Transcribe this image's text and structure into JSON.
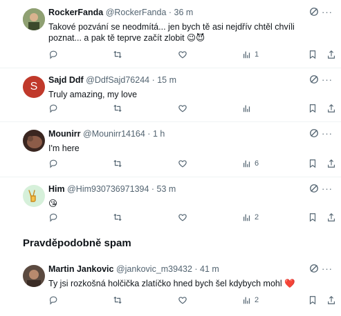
{
  "tweets": [
    {
      "name": "RockerFanda",
      "meta": "@RockerFanda · 36 m",
      "text": "Takové pozvání se neodmítá... jen bych tě asi nejdřív chtěl chvíli poznat... a pak tě teprve začít zlobit 😉😈",
      "reply_count": "",
      "retweet_count": "",
      "like_count": "",
      "view_count": "1",
      "avatar_color": "#6b7d52"
    },
    {
      "name": "Sajd Ddf",
      "meta": "@DdfSajd76244 · 15 m",
      "text": "Truly amazing, my love",
      "reply_count": "",
      "retweet_count": "",
      "like_count": "",
      "view_count": "",
      "avatar_letter": "S",
      "avatar_color": "#c0392b"
    },
    {
      "name": "Mounirr",
      "meta": "@Mounirr14164 · 1 h",
      "text": "I'm here",
      "reply_count": "",
      "retweet_count": "",
      "like_count": "",
      "view_count": "6",
      "avatar_color": "#6e4a3a"
    },
    {
      "name": "Him",
      "meta": "@Him930736971394 · 53 m",
      "text": "😘",
      "reply_count": "",
      "retweet_count": "",
      "like_count": "",
      "view_count": "2",
      "avatar_color": "#d6f0da"
    }
  ],
  "spam_section": {
    "title": "Pravděpodobně spam",
    "tweet": {
      "name": "Martin Jankovic",
      "meta": "@jankovic_m39432 · 41 m",
      "text": "Ty jsi rozkošná holčička zlatíčko hned bych šel kdybych mohl ❤️",
      "view_count": "2",
      "avatar_color": "#7a5a48"
    }
  },
  "colors": {
    "text": "#0f1419",
    "secondary": "#536471",
    "divider": "#eff3f4"
  },
  "icons": [
    "reply-icon",
    "retweet-icon",
    "like-icon",
    "views-icon",
    "bookmark-icon",
    "share-icon",
    "grok-icon",
    "more-icon"
  ]
}
